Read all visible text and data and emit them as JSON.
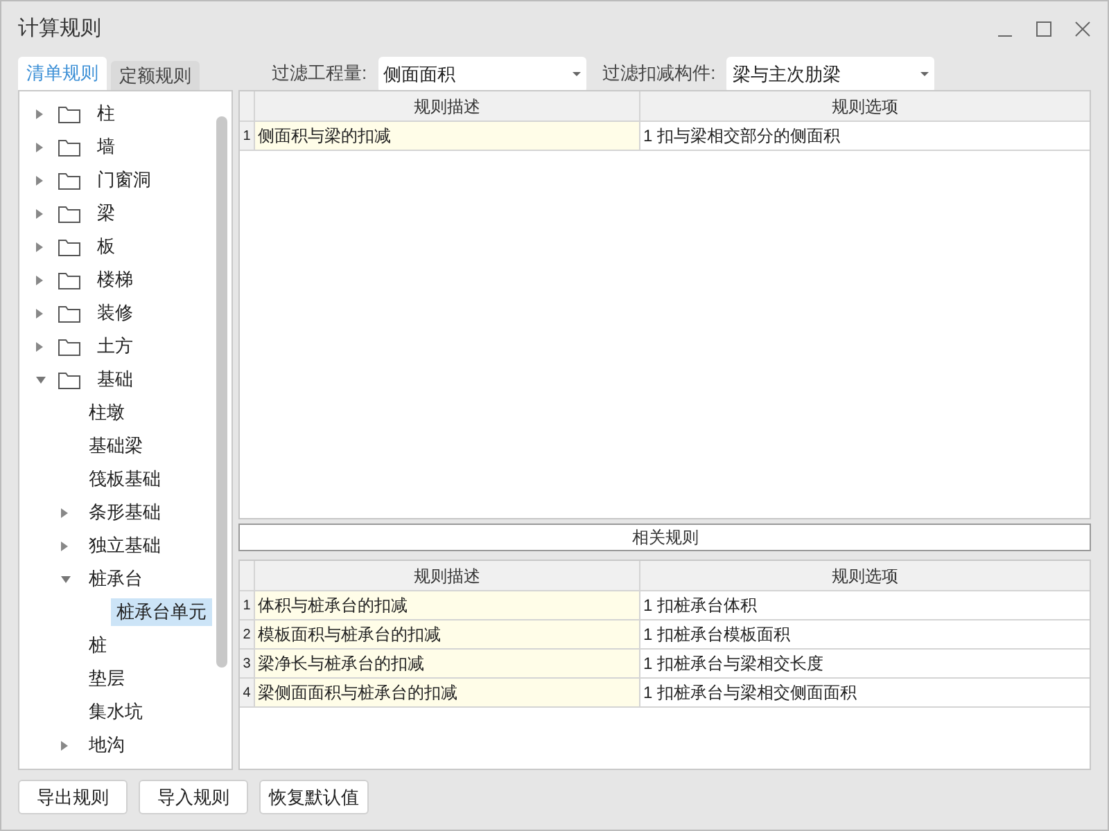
{
  "window": {
    "title": "计算规则"
  },
  "tabs": [
    {
      "label": "清单规则",
      "selected": true
    },
    {
      "label": "定额规则",
      "selected": false
    }
  ],
  "filters": [
    {
      "label": "过滤工程量:",
      "value": "侧面面积"
    },
    {
      "label": "过滤扣减构件:",
      "value": "梁与主次肋梁"
    }
  ],
  "tree": [
    {
      "label": "柱",
      "expanded": false,
      "selected": false
    },
    {
      "label": "墙",
      "expanded": false,
      "selected": false
    },
    {
      "label": "门窗洞",
      "expanded": false,
      "selected": false
    },
    {
      "label": "梁",
      "expanded": false,
      "selected": false
    },
    {
      "label": "板",
      "expanded": false,
      "selected": false
    },
    {
      "label": "楼梯",
      "expanded": false,
      "selected": false
    },
    {
      "label": "装修",
      "expanded": false,
      "selected": false
    },
    {
      "label": "土方",
      "expanded": false,
      "selected": false
    },
    {
      "label": "基础",
      "expanded": true,
      "selected": false,
      "children": [
        {
          "label": "柱墩",
          "selected": false
        },
        {
          "label": "基础梁",
          "selected": false
        },
        {
          "label": "筏板基础",
          "selected": false
        },
        {
          "label": "条形基础",
          "expanded": false,
          "selected": false
        },
        {
          "label": "独立基础",
          "expanded": false,
          "selected": false
        },
        {
          "label": "桩承台",
          "expanded": true,
          "selected": false,
          "children": [
            {
              "label": "桩承台单元",
              "selected": true
            }
          ]
        },
        {
          "label": "桩",
          "selected": false
        },
        {
          "label": "垫层",
          "selected": false
        },
        {
          "label": "集水坑",
          "selected": false
        },
        {
          "label": "地沟",
          "expanded": false,
          "selected": false
        }
      ]
    }
  ],
  "rules_table": {
    "columns": [
      "规则描述",
      "规则选项"
    ],
    "rows": [
      {
        "number": "1",
        "description": "侧面积与梁的扣减",
        "option": "1 扣与梁相交部分的侧面积"
      }
    ]
  },
  "related_title": "相关规则",
  "related_table": {
    "columns": [
      "规则描述",
      "规则选项"
    ],
    "rows": [
      {
        "number": "1",
        "description": "体积与桩承台的扣减",
        "option": "1 扣桩承台体积"
      },
      {
        "number": "2",
        "description": "模板面积与桩承台的扣减",
        "option": "1 扣桩承台模板面积"
      },
      {
        "number": "3",
        "description": "梁净长与桩承台的扣减",
        "option": "1 扣桩承台与梁相交长度"
      },
      {
        "number": "4",
        "description": "梁侧面面积与桩承台的扣减",
        "option": "1 扣桩承台与梁相交侧面面积"
      }
    ]
  },
  "buttons": [
    "导出规则",
    "导入规则",
    "恢复默认值"
  ]
}
